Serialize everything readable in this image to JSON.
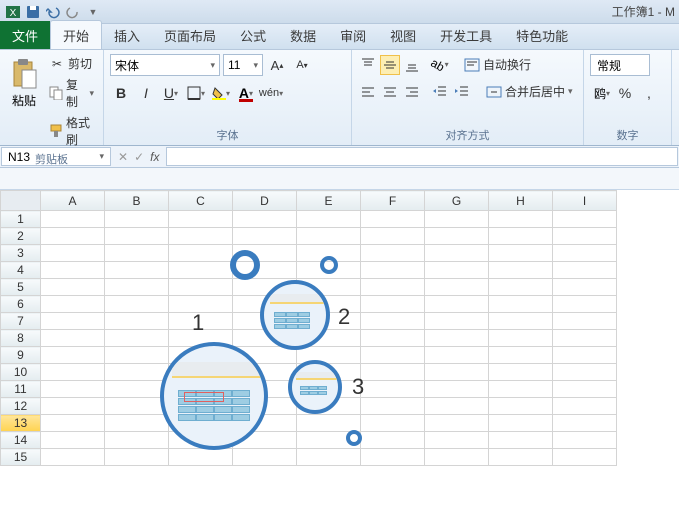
{
  "window": {
    "title": "工作簿1 - M"
  },
  "tabs": {
    "file": "文件",
    "items": [
      "开始",
      "插入",
      "页面布局",
      "公式",
      "数据",
      "审阅",
      "视图",
      "开发工具",
      "特色功能"
    ],
    "active": 0
  },
  "clipboard": {
    "paste": "粘贴",
    "cut": "剪切",
    "copy": "复制",
    "format_painter": "格式刷",
    "group_label": "剪贴板"
  },
  "font": {
    "name": "宋体",
    "size": "11",
    "bold": "B",
    "italic": "I",
    "underline": "U",
    "group_label": "字体"
  },
  "alignment": {
    "wrap": "自动换行",
    "merge": "合并后居中",
    "group_label": "对齐方式"
  },
  "number": {
    "format": "常规",
    "group_label": "数字"
  },
  "name_box": "N13",
  "columns": [
    "A",
    "B",
    "C",
    "D",
    "E",
    "F",
    "G",
    "H",
    "I"
  ],
  "rows": [
    "1",
    "2",
    "3",
    "4",
    "5",
    "6",
    "7",
    "8",
    "9",
    "10",
    "11",
    "12",
    "13",
    "14",
    "15"
  ],
  "selected_row": "13",
  "smartart": {
    "labels": [
      "1",
      "2",
      "3"
    ]
  }
}
